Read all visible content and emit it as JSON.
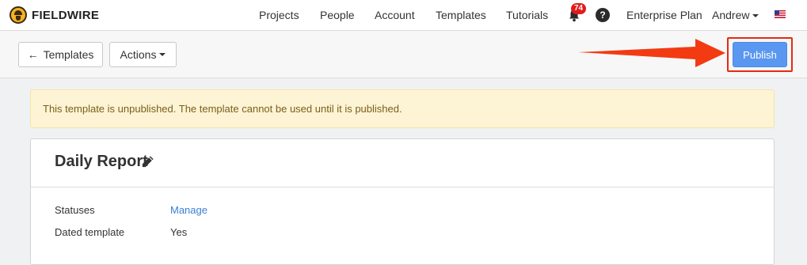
{
  "brand": {
    "name": "FIELDWIRE"
  },
  "nav": {
    "projects": "Projects",
    "people": "People",
    "account": "Account",
    "templates": "Templates",
    "tutorials": "Tutorials",
    "notifications_count": "74",
    "help": "?",
    "plan": "Enterprise Plan",
    "user": "Andrew"
  },
  "toolbar": {
    "back_label": "Templates",
    "actions_label": "Actions",
    "publish_label": "Publish"
  },
  "alert": {
    "text": "This template is unpublished. The template cannot be used until it is published."
  },
  "template": {
    "title": "Daily Report",
    "rows": [
      {
        "label": "Statuses",
        "value": "Manage"
      },
      {
        "label": "Dated template",
        "value": "Yes"
      }
    ]
  },
  "colors": {
    "publish": "#5a97f0",
    "highlight": "#e62a10",
    "badge": "#e11b1b",
    "alert_bg": "#fcf4d4"
  },
  "icons": [
    "logo-icon",
    "bell-icon",
    "help-icon",
    "flag-icon",
    "arrow-left-icon",
    "caret-down-icon",
    "pencil-icon",
    "annotation-arrow"
  ]
}
